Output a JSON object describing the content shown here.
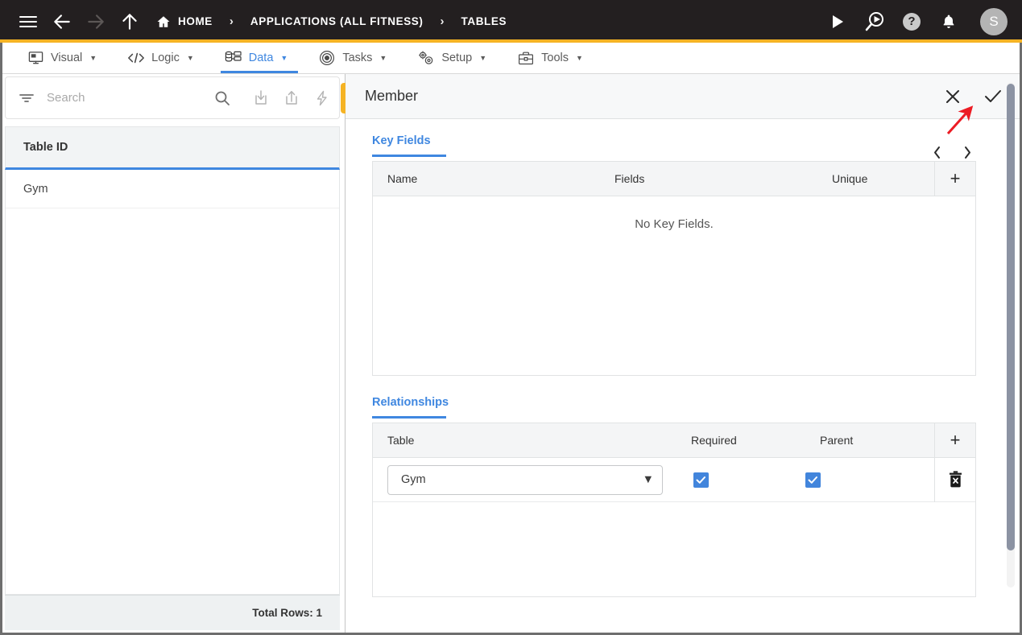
{
  "topbar": {
    "menu_label": "menu",
    "back_label": "back",
    "forward_label": "forward",
    "up_label": "up",
    "breadcrumbs": [
      {
        "label": "HOME",
        "icon": "home-icon"
      },
      {
        "label": "APPLICATIONS (ALL FITNESS)",
        "icon": ""
      },
      {
        "label": "TABLES",
        "icon": ""
      }
    ],
    "separator": "›",
    "actions": [
      {
        "name": "run-icon",
        "glyph": "▶"
      },
      {
        "name": "search-run-icon",
        "glyph": ""
      },
      {
        "name": "help-icon",
        "glyph": "?"
      },
      {
        "name": "notifications-icon",
        "glyph": ""
      }
    ],
    "avatar_initial": "S"
  },
  "menubar": {
    "items": [
      {
        "label": "Visual",
        "icon": "monitor-icon",
        "caret": "▼",
        "active": false
      },
      {
        "label": "Logic",
        "icon": "code-icon",
        "caret": "▼",
        "active": false
      },
      {
        "label": "Data",
        "icon": "database-icon",
        "caret": "▼",
        "active": true
      },
      {
        "label": "Tasks",
        "icon": "target-icon",
        "caret": "▼",
        "active": false
      },
      {
        "label": "Setup",
        "icon": "gears-icon",
        "caret": "▼",
        "active": false
      },
      {
        "label": "Tools",
        "icon": "toolbox-icon",
        "caret": "▼",
        "active": false
      }
    ]
  },
  "sidebar": {
    "search": {
      "placeholder": "Search",
      "value": ""
    },
    "toolbar_icons": [
      {
        "name": "filter-icon"
      },
      {
        "name": "search-icon"
      },
      {
        "name": "import-icon"
      },
      {
        "name": "export-icon"
      },
      {
        "name": "lightning-icon"
      },
      {
        "name": "add-icon",
        "glyph": "+"
      }
    ],
    "column_header": "Table ID",
    "rows": [
      {
        "table_id": "Gym"
      }
    ],
    "footer": "Total Rows: 1"
  },
  "panel": {
    "title": "Member",
    "close_label": "✕",
    "confirm_label": "✓",
    "pager_prev": "‹",
    "pager_next": "›",
    "key_fields": {
      "tab_label": "Key Fields",
      "columns": [
        "Name",
        "Fields",
        "Unique"
      ],
      "add_label": "+",
      "empty_message": "No Key Fields.",
      "rows": []
    },
    "relationships": {
      "tab_label": "Relationships",
      "columns": [
        "Table",
        "Required",
        "Parent"
      ],
      "add_label": "+",
      "rows": [
        {
          "table": "Gym",
          "required": true,
          "parent": true,
          "delete_label": "delete-row"
        }
      ]
    }
  },
  "colors": {
    "accent_yellow": "#f5b324",
    "accent_blue": "#3f87e0",
    "checkbox_blue": "#4285dc",
    "topbar_dark": "#231f20",
    "annotation_red": "#ec1c24"
  }
}
